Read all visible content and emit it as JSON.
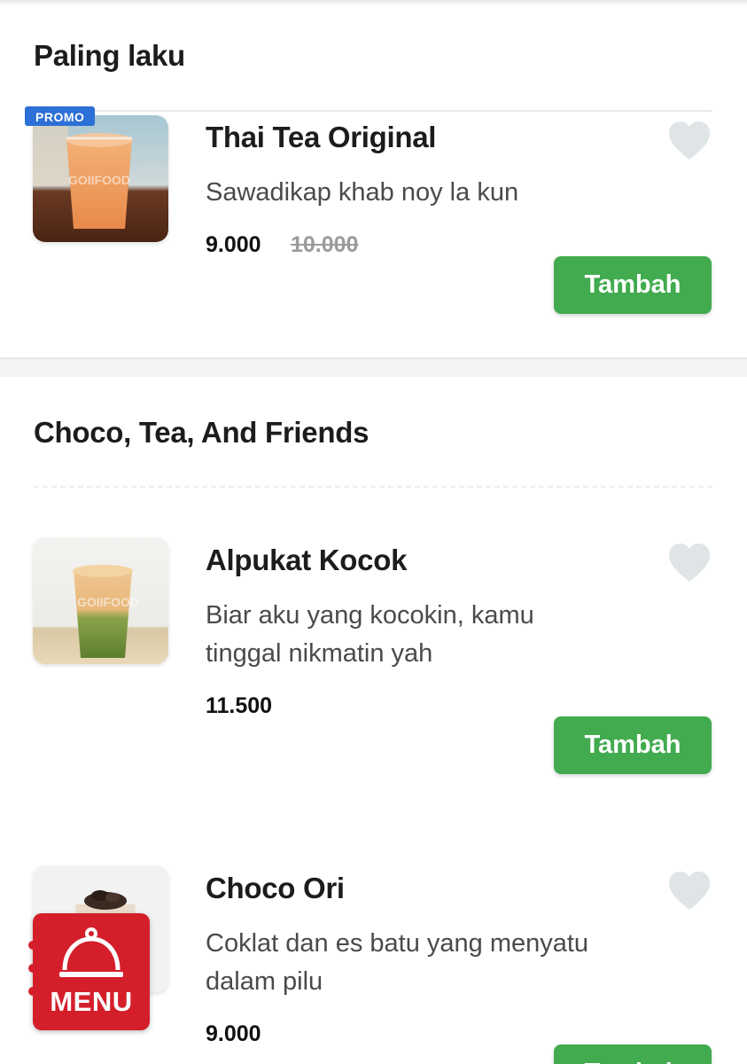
{
  "sections": [
    {
      "title": "Paling laku",
      "items": [
        {
          "name": "Thai Tea Original",
          "description": "Sawadikap khab noy la kun",
          "price": "9.000",
          "original_price": "10.000",
          "badge": "PROMO",
          "watermark": "GOIIFOOD",
          "add_label": "Tambah"
        }
      ]
    },
    {
      "title": "Choco, Tea, And Friends",
      "items": [
        {
          "name": "Alpukat Kocok",
          "description_lines": [
            "Biar aku yang kocokin, kamu",
            "tinggal nikmatin yah"
          ],
          "price": "11.500",
          "watermark": "GOIIFOOD",
          "add_label": "Tambah"
        },
        {
          "name": "Choco Ori",
          "description_lines": [
            "Coklat dan es batu yang menyatu",
            "dalam pilu"
          ],
          "price": "9.000",
          "add_label": "Tambah"
        }
      ]
    }
  ],
  "menu_button": {
    "label": "MENU",
    "icon": "cloche-icon",
    "color": "#d41f2b"
  },
  "colors": {
    "accent_green": "#42ab4f",
    "promo_blue": "#2c6fd6",
    "heart_gray": "#dfe4e6"
  }
}
